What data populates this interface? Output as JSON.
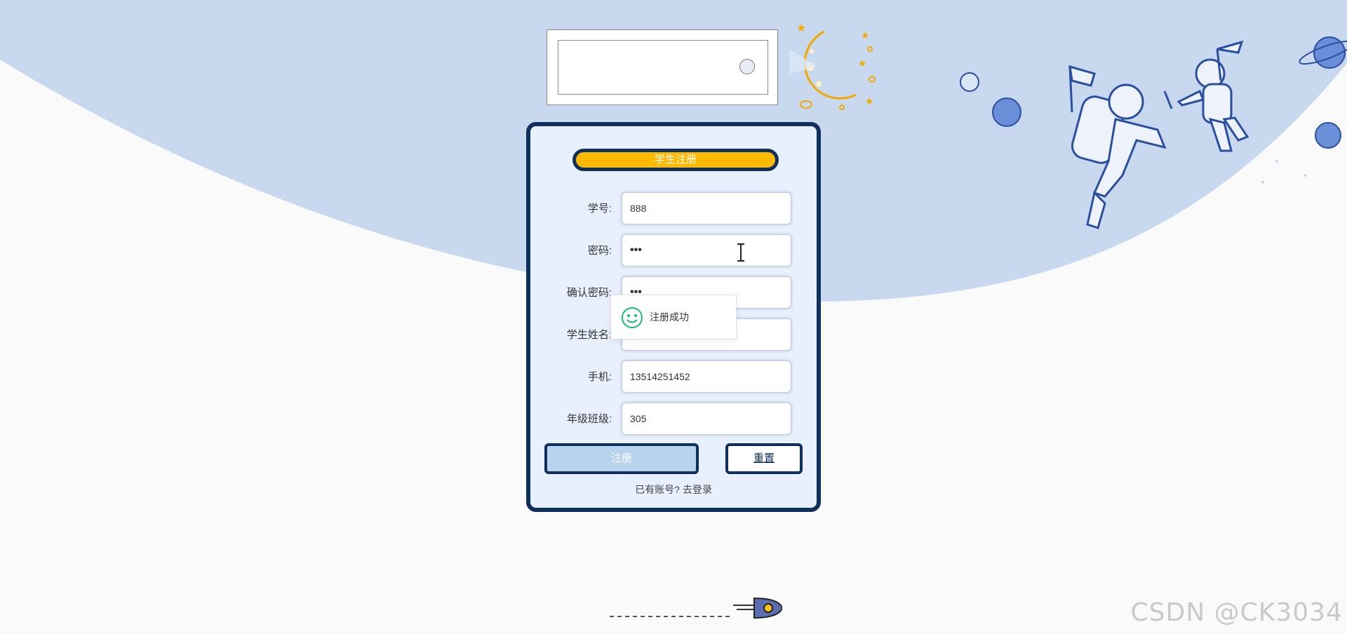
{
  "form": {
    "title": "学生注册",
    "fields": [
      {
        "label": "学号:",
        "value": "888",
        "type": "text"
      },
      {
        "label": "密码:",
        "value": "•••",
        "type": "password"
      },
      {
        "label": "确认密码:",
        "value": "•••",
        "type": "password"
      },
      {
        "label": "学生姓名:",
        "value": "",
        "type": "text"
      },
      {
        "label": "手机:",
        "value": "13514251452",
        "type": "text"
      },
      {
        "label": "年级班级:",
        "value": "305",
        "type": "text"
      }
    ],
    "register_label": "注册",
    "reset_label": "重置",
    "login_link": "已有账号? 去登录"
  },
  "toast": {
    "message": "注册成功",
    "icon": "smile-icon"
  },
  "watermark": "CSDN @CK3034",
  "colors": {
    "sky": "#c8d8ef",
    "card_border": "#0f2f5c",
    "card_bg": "#e8f0fd",
    "title_pill": "#ffb900",
    "register_btn": "#b8d3ee",
    "toast_icon": "#19be6b"
  }
}
